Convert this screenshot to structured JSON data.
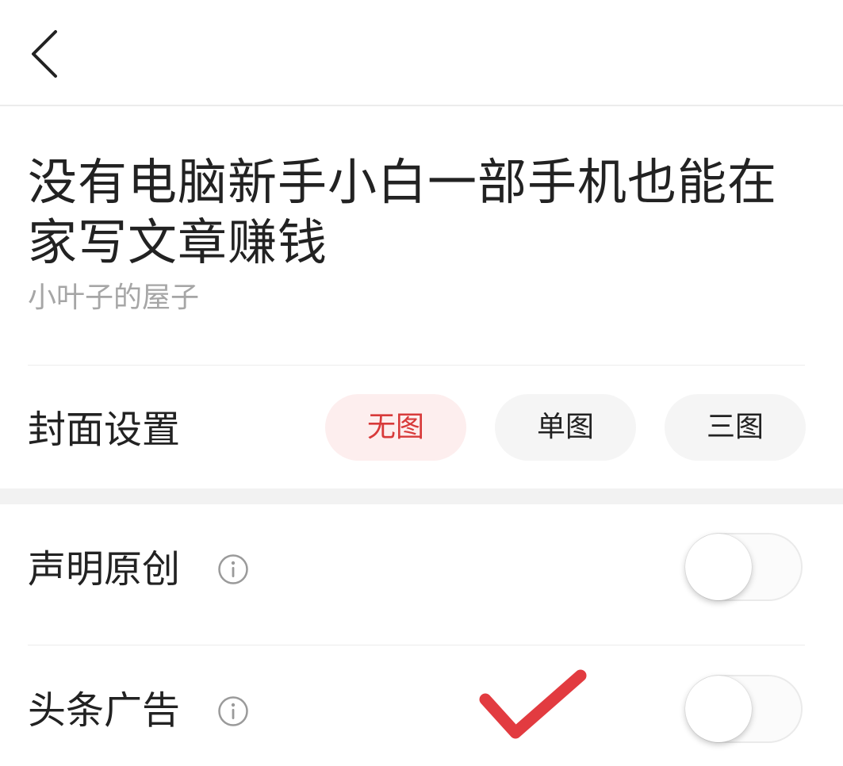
{
  "header": {
    "back_icon": "chevron-left-icon"
  },
  "article": {
    "title": "没有电脑新手小白一部手机也能在家写文章赚钱",
    "author": "小叶子的屋子"
  },
  "cover": {
    "label": "封面设置",
    "options": [
      {
        "label": "无图",
        "selected": true
      },
      {
        "label": "单图",
        "selected": false
      },
      {
        "label": "三图",
        "selected": false
      }
    ],
    "selected_color": "#d83a3a"
  },
  "settings": {
    "original": {
      "label": "声明原创",
      "icon": "info-icon",
      "enabled": false
    },
    "ads": {
      "label": "头条广告",
      "icon": "info-icon",
      "enabled": false
    }
  },
  "annotation": {
    "icon": "checkmark-icon",
    "color": "#e23b40"
  }
}
